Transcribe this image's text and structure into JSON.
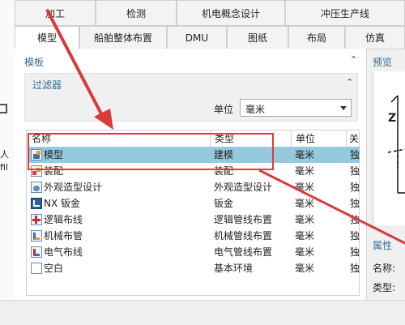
{
  "top_tabs": [
    "加工",
    "检测",
    "机电概念设计",
    "冲压生产线"
  ],
  "sub_tabs": [
    "模型",
    "船舶整体布置",
    "DMU",
    "图纸",
    "布局",
    "仿真"
  ],
  "templates": {
    "title": "模板",
    "filter": {
      "title": "过滤器",
      "unit_label": "单位",
      "unit_value": "毫米"
    },
    "columns": [
      "名称",
      "类型",
      "单位",
      "关"
    ],
    "rows": [
      {
        "name": "模型",
        "type": "建模",
        "unit": "毫米",
        "extra": "独",
        "icon": "model-icon",
        "selected": true
      },
      {
        "name": "装配",
        "type": "装配",
        "unit": "毫米",
        "extra": "独",
        "icon": "assembly-icon",
        "selected": false
      },
      {
        "name": "外观造型设计",
        "type": "外观造型设计",
        "unit": "毫米",
        "extra": "独",
        "icon": "shape-studio-icon",
        "selected": false
      },
      {
        "name": "NX 钣金",
        "type": "钣金",
        "unit": "毫米",
        "extra": "独",
        "icon": "sheet-metal-icon",
        "selected": false
      },
      {
        "name": "逻辑布线",
        "type": "逻辑管线布置",
        "unit": "毫米",
        "extra": "独",
        "icon": "logical-routing-icon",
        "selected": false
      },
      {
        "name": "机械布管",
        "type": "机械管线布置",
        "unit": "毫米",
        "extra": "独",
        "icon": "mechanical-routing-icon",
        "selected": false
      },
      {
        "name": "电气布线",
        "type": "电气管线布置",
        "unit": "毫米",
        "extra": "独",
        "icon": "electrical-routing-icon",
        "selected": false
      },
      {
        "name": "空白",
        "type": "基本环境",
        "unit": "毫米",
        "extra": "独",
        "icon": "blank-icon",
        "selected": false
      }
    ]
  },
  "preview": {
    "title": "预览",
    "axis_label": "Z",
    "properties": {
      "title": "属性",
      "name_label": "名称:",
      "type_label": "类型:"
    }
  },
  "left_edge": {
    "text1": "人",
    "text2": "fil"
  },
  "colors": {
    "accent": "#2f6f97",
    "selected_row": "#95c9dd",
    "highlight_red": "#e53935",
    "arrow_red": "#d93a3a"
  }
}
